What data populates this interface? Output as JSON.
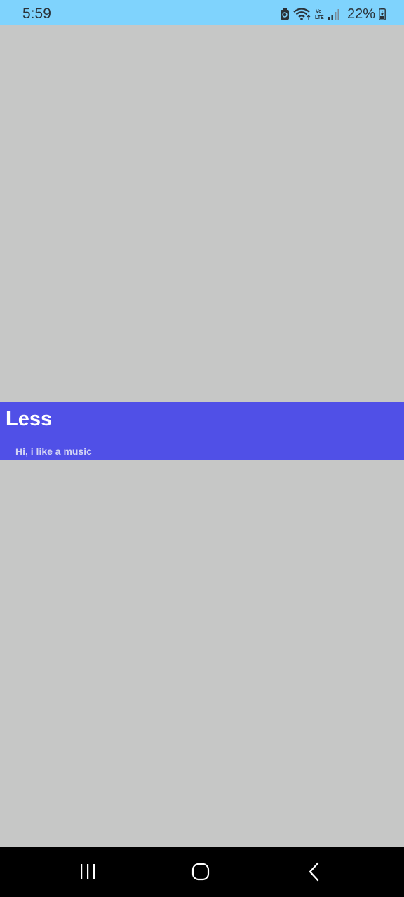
{
  "status_bar": {
    "time": "5:59",
    "network_type": "Vo LTE",
    "battery_percent": "22%",
    "background_color": "#7fd3fd",
    "icons": [
      "shield-icon",
      "wifi-icon",
      "volte-icon",
      "signal-icon",
      "battery-icon"
    ]
  },
  "card": {
    "title": "Less",
    "subtitle": "Hi, i like a music",
    "background_color": "#5050e7"
  },
  "navigation_bar": {
    "icons": [
      "recent-apps-icon",
      "home-icon",
      "back-icon"
    ]
  }
}
